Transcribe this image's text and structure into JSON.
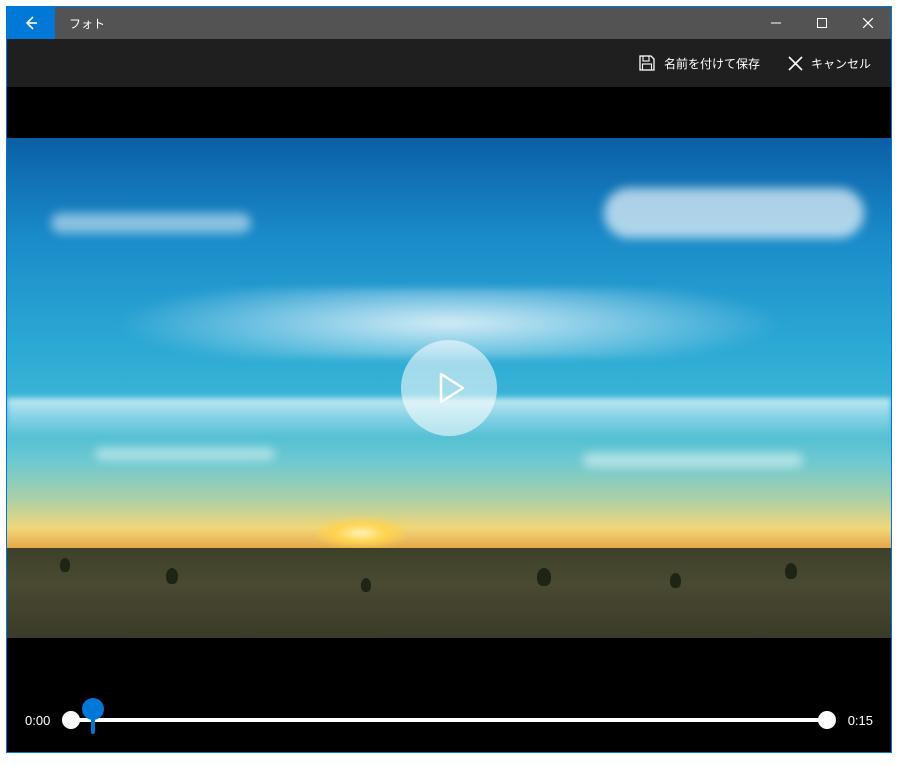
{
  "titlebar": {
    "title": "フォト"
  },
  "toolbar": {
    "save_label": "名前を付けて保存",
    "cancel_label": "キャンセル"
  },
  "timeline": {
    "start_time": "0:00",
    "end_time": "0:15"
  },
  "colors": {
    "accent": "#0078d7"
  }
}
